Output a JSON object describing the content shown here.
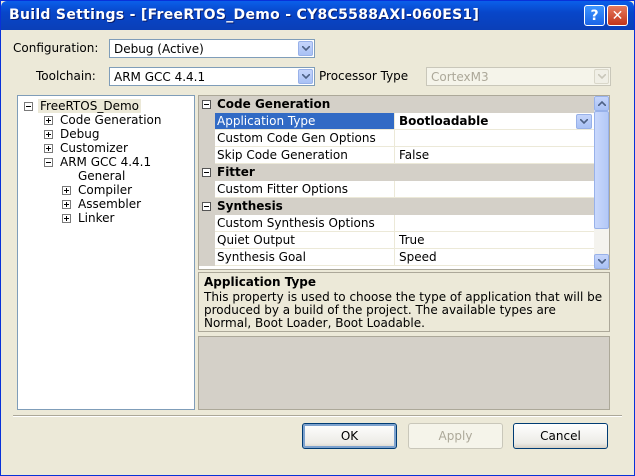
{
  "window": {
    "title": "Build Settings - [FreeRTOS_Demo - CY8C5588AXI-060ES1]",
    "help_glyph": "?",
    "close_glyph": "✕"
  },
  "configuration": {
    "label": "Configuration:",
    "value": "Debug (Active)"
  },
  "toolchain": {
    "label": "Toolchain:",
    "value": "ARM GCC 4.4.1"
  },
  "processor_type": {
    "label": "Processor Type",
    "value": "CortexM3"
  },
  "tree": {
    "root": "FreeRTOS_Demo",
    "items": [
      {
        "label": "Code Generation"
      },
      {
        "label": "Debug"
      },
      {
        "label": "Customizer"
      },
      {
        "label": "ARM GCC 4.4.1"
      },
      {
        "label": "General"
      },
      {
        "label": "Compiler"
      },
      {
        "label": "Assembler"
      },
      {
        "label": "Linker"
      }
    ]
  },
  "grid": {
    "categories": [
      {
        "label": "Code Generation"
      },
      {
        "label": "Fitter"
      },
      {
        "label": "Synthesis"
      }
    ],
    "rows": [
      {
        "name": "Application Type",
        "value": "Bootloadable"
      },
      {
        "name": "Custom Code Gen Options",
        "value": ""
      },
      {
        "name": "Skip Code Generation",
        "value": "False"
      },
      {
        "name": "Custom Fitter Options",
        "value": ""
      },
      {
        "name": "Custom Synthesis Options",
        "value": ""
      },
      {
        "name": "Quiet Output",
        "value": "True"
      },
      {
        "name": "Synthesis Goal",
        "value": "Speed"
      }
    ]
  },
  "description": {
    "title": "Application Type",
    "body": "This property is used to choose the type of application that will be produced by a build of the project. The available types are Normal, Boot Loader, Boot Loadable."
  },
  "buttons": {
    "ok": "OK",
    "apply": "Apply",
    "cancel": "Cancel"
  },
  "colors": {
    "selection": "#316ac5",
    "titlebar": "#0a5fea",
    "dialog_bg": "#ece9d8"
  }
}
